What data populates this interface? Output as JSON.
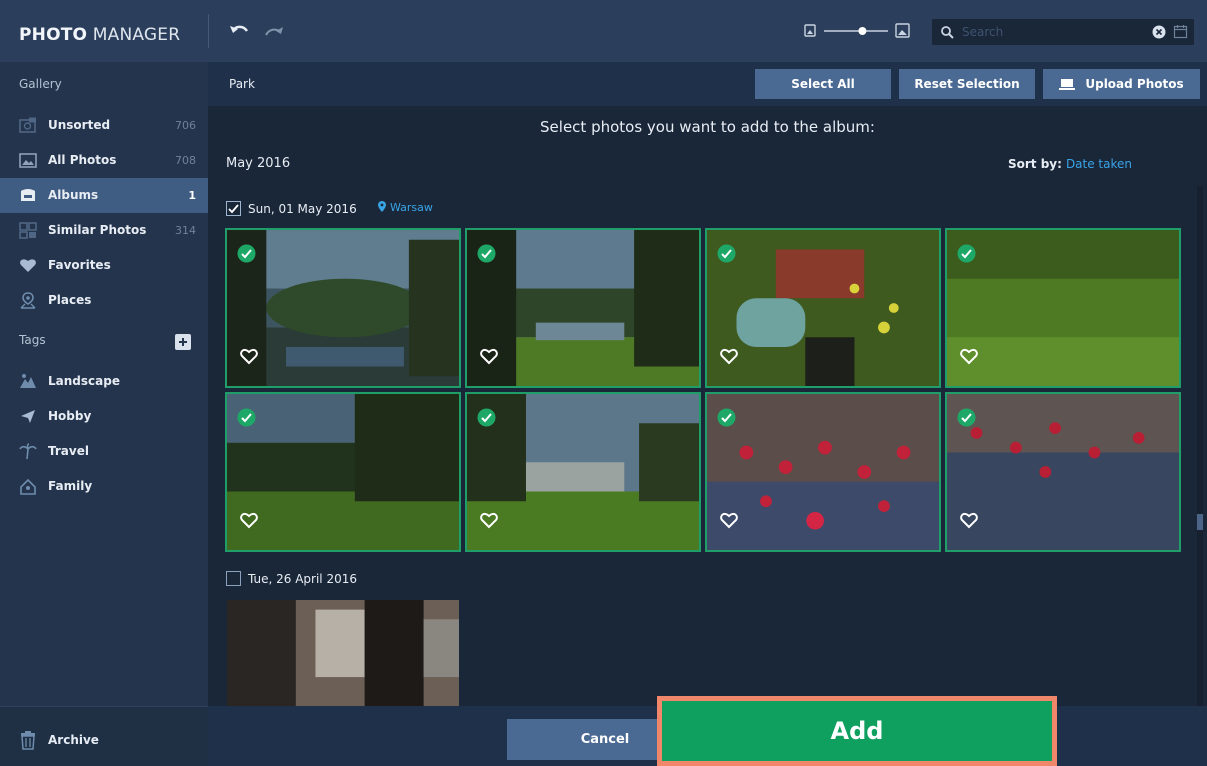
{
  "app": {
    "title_bold": "PHOTO",
    "title_rest": " MANAGER"
  },
  "toolbar": {
    "undo_icon": "undo-icon",
    "redo_icon": "redo-icon",
    "zoom_level": 0.6
  },
  "search": {
    "placeholder": "Search",
    "value": ""
  },
  "sidebar": {
    "gallery_heading": "Gallery",
    "items": [
      {
        "label": "Unsorted",
        "count": "706",
        "icon": "unsorted-icon"
      },
      {
        "label": "All Photos",
        "count": "708",
        "icon": "photos-icon"
      },
      {
        "label": "Albums",
        "count": "1",
        "icon": "albums-icon",
        "active": true
      },
      {
        "label": "Similar Photos",
        "count": "314",
        "icon": "similar-icon"
      },
      {
        "label": "Favorites",
        "count": "",
        "icon": "heart-icon"
      },
      {
        "label": "Places",
        "count": "",
        "icon": "pin-icon"
      }
    ],
    "tags_heading": "Tags",
    "tags": [
      {
        "label": "Landscape",
        "icon": "landscape-icon"
      },
      {
        "label": "Hobby",
        "icon": "hobby-icon"
      },
      {
        "label": "Travel",
        "icon": "palm-icon"
      },
      {
        "label": "Family",
        "icon": "family-icon"
      }
    ],
    "archive": "Archive"
  },
  "subbar": {
    "breadcrumb": "Park",
    "select_all": "Select All",
    "reset_selection": "Reset Selection",
    "upload_photos": "Upload Photos"
  },
  "main": {
    "instruction": "Select photos you want to add to the album:",
    "month": "May 2016",
    "sort_label": "Sort by:",
    "sort_value": "Date taken",
    "day1": {
      "label": "Sun, 01 May 2016",
      "location": "Warsaw",
      "checked": true
    },
    "day2": {
      "label": "Tue, 26 April 2016",
      "checked": false
    }
  },
  "footer": {
    "cancel": "Cancel",
    "add": "Add"
  },
  "colors": {
    "accent_green": "#0fa060",
    "highlight": "#f0866a",
    "link_blue": "#3aa3e6",
    "button_blue": "#4a6a93"
  }
}
